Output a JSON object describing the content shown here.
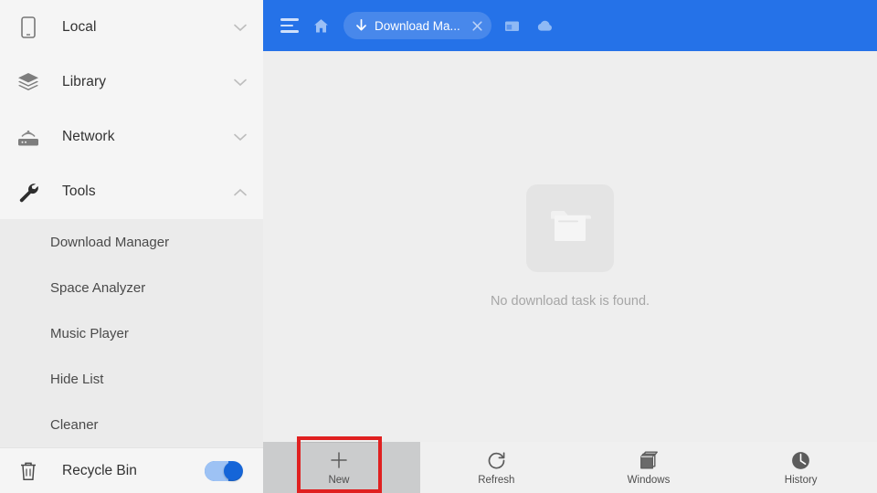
{
  "sidebar": {
    "groups": [
      {
        "label": "Local",
        "icon": "phone-icon",
        "expanded": false,
        "chevron": "chevron-down-icon"
      },
      {
        "label": "Library",
        "icon": "layers-icon",
        "expanded": false,
        "chevron": "chevron-down-icon"
      },
      {
        "label": "Network",
        "icon": "router-icon",
        "expanded": false,
        "chevron": "chevron-down-icon"
      },
      {
        "label": "Tools",
        "icon": "wrench-icon",
        "expanded": true,
        "chevron": "chevron-up-icon"
      }
    ],
    "tools_items": [
      {
        "label": "Download Manager"
      },
      {
        "label": "Space Analyzer"
      },
      {
        "label": "Music Player"
      },
      {
        "label": "Hide List"
      },
      {
        "label": "Cleaner"
      }
    ],
    "recycle_bin": {
      "label": "Recycle Bin",
      "icon": "trash-icon",
      "toggle_on": true
    }
  },
  "header": {
    "menu_icon": "hamburger-menu-icon",
    "home_icon": "home-icon",
    "tab": {
      "icon": "download-arrow-icon",
      "title": "Download Ma...",
      "close_icon": "close-icon"
    },
    "window_icon": "window-icon",
    "cloud_icon": "cloud-icon",
    "accent_color": "#2572e8"
  },
  "main": {
    "empty_icon": "folder-icon",
    "empty_text": "No download task is found."
  },
  "bottombar": {
    "items": [
      {
        "label": "New",
        "icon": "plus-icon"
      },
      {
        "label": "Refresh",
        "icon": "refresh-icon"
      },
      {
        "label": "Windows",
        "icon": "windows-stack-icon"
      },
      {
        "label": "History",
        "icon": "clock-icon"
      }
    ]
  },
  "highlight": {
    "target": "New",
    "color": "#e02020"
  }
}
